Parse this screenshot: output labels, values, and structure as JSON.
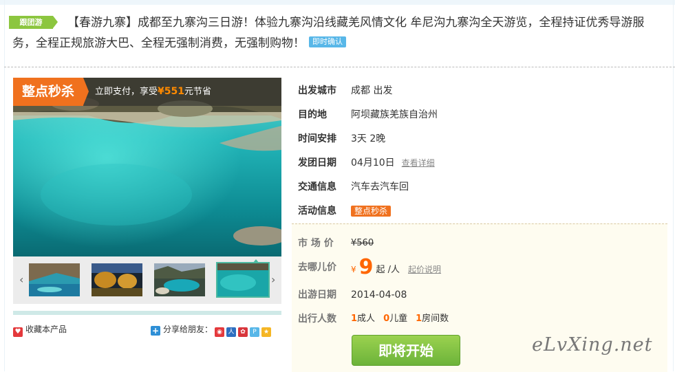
{
  "tag": "跟团游",
  "title": "【春游九寨】成都至九寨沟三日游！体验九寨沟沿线藏羌风情文化 牟尼沟九寨沟全天游览，全程持证优秀导游服务，全程正规旅游大巴、全程无强制消费，无强制购物！",
  "confirm_badge": "即时确认",
  "promo": {
    "tag": "整点秒杀",
    "text_prefix": "立即支付，享受",
    "currency": "¥",
    "amount": "551",
    "text_suffix": "元节省"
  },
  "gallery": {
    "prev_icon": "‹",
    "next_icon": "›",
    "selected_index": 3,
    "thumbs": [
      "thumb-1",
      "thumb-2",
      "thumb-3",
      "thumb-4"
    ]
  },
  "actions": {
    "favorite": "收藏本产品",
    "share_label": "分享给朋友：",
    "share_icons": [
      "weibo-icon",
      "renren-icon",
      "kaixin-icon",
      "pinterest-icon",
      "qzone-icon"
    ]
  },
  "info": {
    "depart_city": {
      "label": "出发城市",
      "value": "成都 出发"
    },
    "destination": {
      "label": "目的地",
      "value": "阿坝藏族羌族自治州"
    },
    "schedule": {
      "label": "时间安排",
      "value": "3天 2晚"
    },
    "depart_date": {
      "label": "发团日期",
      "value": "04月10日",
      "link": "查看详细"
    },
    "transport": {
      "label": "交通信息",
      "value": "汽车去汽车回"
    },
    "activity": {
      "label": "活动信息",
      "value": "整点秒杀"
    }
  },
  "price": {
    "market": {
      "label": "市 场 价",
      "value": "¥560"
    },
    "qunar": {
      "label": "去哪儿价",
      "currency": "¥",
      "value": "9",
      "unit": "起 /人",
      "link": "起价说明"
    },
    "travel_date": {
      "label": "出游日期",
      "value": "2014-04-08"
    },
    "travelers": {
      "label": "出行人数",
      "adults": "1",
      "adults_label": "成人",
      "children": "0",
      "children_label": "儿童",
      "rooms": "1",
      "rooms_label": "房间数"
    }
  },
  "cta": "即将开始",
  "watermark": "eLvXing.net",
  "colors": {
    "accent_orange": "#f0711e",
    "price_orange": "#ff6600",
    "tag_green": "#8cc63f",
    "button_green": "#6cb33a",
    "teal": "#4cb9a0",
    "confirm_blue": "#58b7e8"
  }
}
